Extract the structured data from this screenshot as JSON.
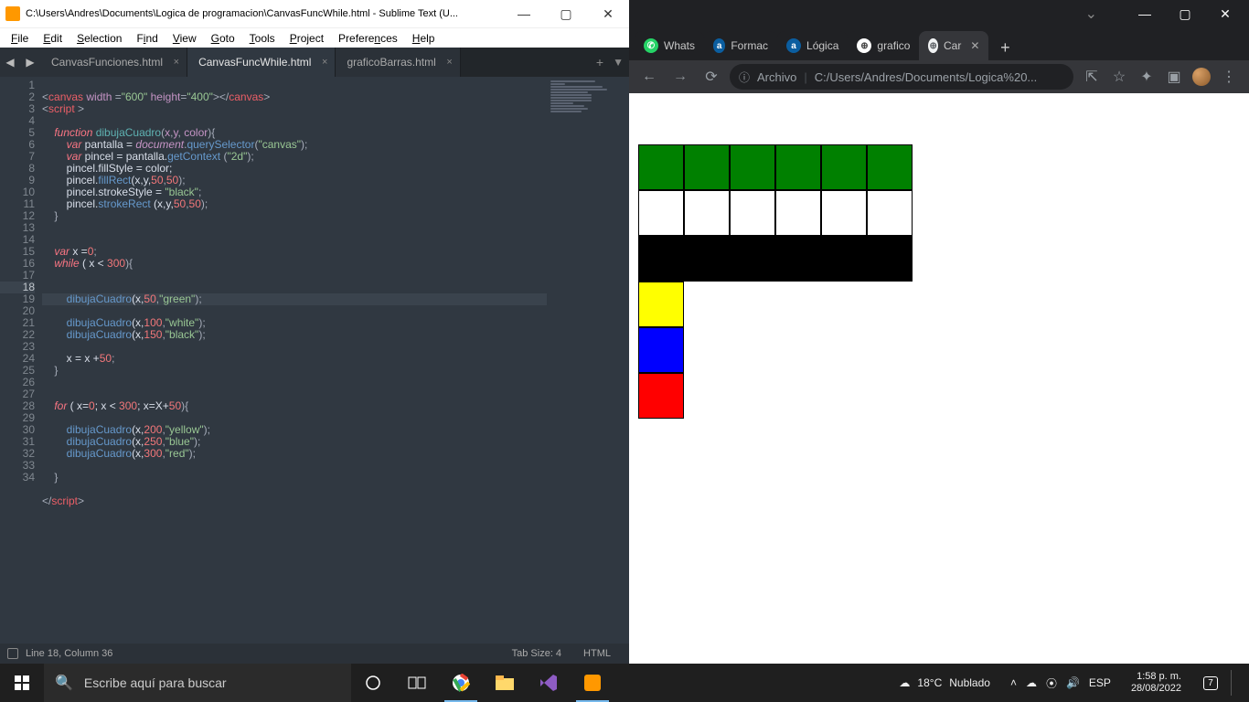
{
  "sublime": {
    "title": "C:\\Users\\Andres\\Documents\\Logica de programacion\\CanvasFuncWhile.html - Sublime Text (U...",
    "menu": [
      "File",
      "Edit",
      "Selection",
      "Find",
      "View",
      "Goto",
      "Tools",
      "Project",
      "Preferences",
      "Help"
    ],
    "tabs": [
      {
        "label": "CanvasFunciones.html",
        "active": false
      },
      {
        "label": "CanvasFuncWhile.html",
        "active": true
      },
      {
        "label": "graficoBarras.html",
        "active": false
      }
    ],
    "highlight_line": 18,
    "status": {
      "pos": "Line 18, Column 36",
      "tab": "Tab Size: 4",
      "lang": "HTML"
    },
    "code": {
      "l1a": "<",
      "l1b": "canvas",
      "l1c": " width",
      "l1d": " =",
      "l1e": "\"600\"",
      "l1f": " height",
      "l1g": "=",
      "l1h": "\"400\"",
      "l1i": "></",
      "l1j": "canvas",
      "l1k": ">",
      "l2a": "<",
      "l2b": "script",
      "l2c": " >",
      "l4a": "    function",
      "l4b": " dibujaCuadro",
      "l4c": "(",
      "l4d": "x",
      "l4e": ",",
      "l4f": "y",
      "l4g": ",",
      "l4h": " color",
      "l4i": "){",
      "l5a": "        var",
      "l5b": " pantalla = ",
      "l5c": "document",
      "l5d": ".",
      "l5e": "querySelector",
      "l5f": "(",
      "l5g": "\"canvas\"",
      "l5h": ");",
      "l6a": "        var",
      "l6b": " pincel = pantalla.",
      "l6c": "getContext",
      "l6d": " (",
      "l6e": "\"2d\"",
      "l6f": ");",
      "l7": "        pincel.fillStyle = color;",
      "l8a": "        pincel.",
      "l8b": "fillRect",
      "l8c": "(x,y,",
      "l8d": "50",
      "l8e": ",",
      "l8f": "50",
      "l8g": ");",
      "l9a": "        pincel.strokeStyle = ",
      "l9b": "\"black\"",
      "l9c": ";",
      "l10a": "        pincel.",
      "l10b": "strokeRect",
      "l10c": " (x,y,",
      "l10d": "50",
      "l10e": ",",
      "l10f": "50",
      "l10g": ");",
      "l11": "    }",
      "l14a": "    var",
      "l14b": " x =",
      "l14c": "0",
      "l14d": ";",
      "l15a": "    while",
      "l15b": " ( x < ",
      "l15c": "300",
      "l15d": "){",
      "l18a": "        dibujaCuadro",
      "l18b": "(x,",
      "l18c": "50",
      "l18d": ",",
      "l18e": "\"green\"",
      "l18f": ");",
      "l19a": "        dibujaCuadro",
      "l19b": "(x,",
      "l19c": "100",
      "l19d": ",",
      "l19e": "\"white\"",
      "l19f": ");",
      "l20a": "        dibujaCuadro",
      "l20b": "(x,",
      "l20c": "150",
      "l20d": ",",
      "l20e": "\"black\"",
      "l20f": ");",
      "l22a": "        x = x +",
      "l22b": "50",
      "l22c": ";",
      "l23": "    }",
      "l26a": "    for",
      "l26b": " ( x=",
      "l26c": "0",
      "l26d": "; x < ",
      "l26e": "300",
      "l26f": "; x=X+",
      "l26g": "50",
      "l26h": "){",
      "l28a": "        dibujaCuadro",
      "l28b": "(x,",
      "l28c": "200",
      "l28d": ",",
      "l28e": "\"yellow\"",
      "l28f": ");",
      "l29a": "        dibujaCuadro",
      "l29b": "(x,",
      "l29c": "250",
      "l29d": ",",
      "l29e": "\"blue\"",
      "l29f": ");",
      "l30a": "        dibujaCuadro",
      "l30b": "(x,",
      "l30c": "300",
      "l30d": ",",
      "l30e": "\"red\"",
      "l30f": ");",
      "l32": "    }",
      "l34a": "</",
      "l34b": "script",
      "l34c": ">"
    }
  },
  "chrome": {
    "tabs": [
      {
        "label": "Whats",
        "active": false
      },
      {
        "label": "Formac",
        "active": false
      },
      {
        "label": "Lógica",
        "active": false
      },
      {
        "label": "grafico",
        "active": false
      },
      {
        "label": "Car",
        "active": true
      }
    ],
    "addr_scheme": "Archivo",
    "addr_path": "C:/Users/Andres/Documents/Logica%20...",
    "canvas": {
      "rows": [
        {
          "color": "#008000",
          "count": 6
        },
        {
          "color": "#ffffff",
          "count": 6
        },
        {
          "color": "#000000",
          "count": 6
        },
        {
          "color": "#ffff00",
          "count": 1
        },
        {
          "color": "#0000ff",
          "count": 1
        },
        {
          "color": "#ff0000",
          "count": 1
        }
      ]
    }
  },
  "taskbar": {
    "search_placeholder": "Escribe aquí para buscar",
    "weather_temp": "18°C",
    "weather_cond": "Nublado",
    "lang": "ESP",
    "time": "1:58 p. m.",
    "date": "28/08/2022",
    "notif": "7"
  }
}
